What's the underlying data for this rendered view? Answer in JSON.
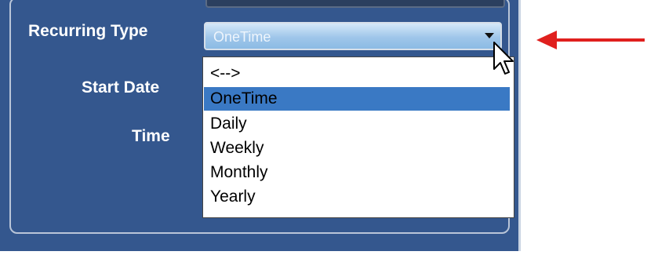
{
  "form": {
    "recurring_label": "Recurring Type",
    "start_label": "Start Date",
    "time_label": "Time"
  },
  "select": {
    "value": "OneTime",
    "options": [
      "<-->",
      "OneTime",
      "Daily",
      "Weekly",
      "Monthly",
      "Yearly"
    ],
    "selected_index": 1
  },
  "colors": {
    "panel": "#34578e",
    "highlight": "#3a79c4",
    "annotation_arrow": "#e0201e"
  }
}
